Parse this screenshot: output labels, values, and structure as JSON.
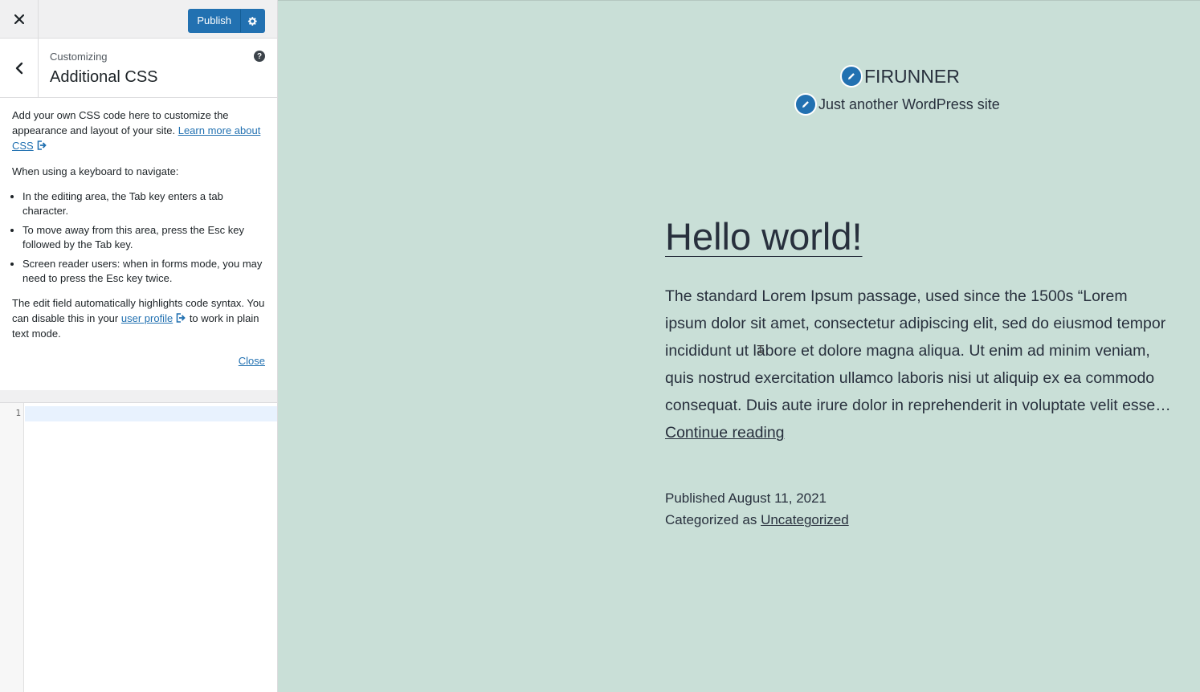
{
  "toolbar": {
    "close_icon": "close-icon",
    "publish_label": "Publish",
    "settings_icon": "gear-icon"
  },
  "section": {
    "breadcrumb": "Customizing",
    "title": "Additional CSS",
    "help_icon_glyph": "?"
  },
  "description": {
    "intro": "Add your own CSS code here to customize the appearance and layout of your site.",
    "learn_more_link": "Learn more about CSS",
    "keyboard_heading": "When using a keyboard to navigate:",
    "tips": [
      "In the editing area, the Tab key enters a tab character.",
      "To move away from this area, press the Esc key followed by the Tab key.",
      "Screen reader users: when in forms mode, you may need to press the Esc key twice."
    ],
    "syntax_pre": "The edit field automatically highlights code syntax. You can disable this in your",
    "profile_link": "user profile",
    "syntax_post": "to work in plain text mode.",
    "close_label": "Close"
  },
  "editor": {
    "line_numbers": [
      "1"
    ],
    "content": ""
  },
  "preview": {
    "site_title": "FIRUNNER",
    "tagline": "Just another WordPress site",
    "post": {
      "title": "Hello world!",
      "excerpt": "The standard Lorem Ipsum passage, used since the 1500s “Lorem ipsum dolor sit amet, consectetur adipiscing elit, sed do eiusmod tempor incididunt ut labore et dolore magna aliqua. Ut enim ad minim veniam, quis nostrud exercitation ullamco laboris nisi ut aliquip ex ea commodo consequat. Duis aute irure dolor in reprehenderit in voluptate velit esse…",
      "continue_label": "Continue reading",
      "published": "Published August 11, 2021",
      "categorized_prefix": "Categorized as",
      "category": "Uncategorized"
    }
  },
  "colors": {
    "accent": "#2271b1",
    "preview_bg": "#c9dfd7",
    "text": "#28303d"
  }
}
